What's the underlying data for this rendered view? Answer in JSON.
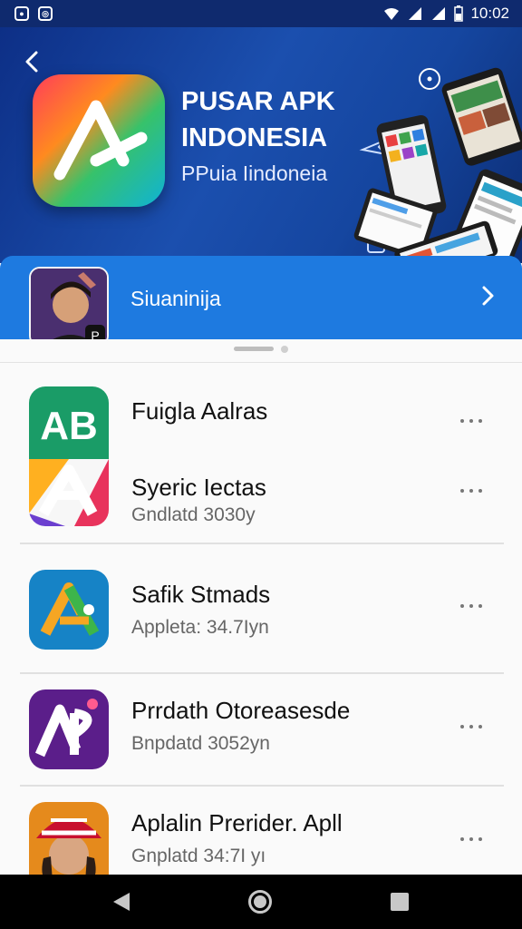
{
  "status_bar": {
    "time": "10:02"
  },
  "hero": {
    "title": "PUSAR APK INDONESIA",
    "subtitle": "PPuia Iindoneia"
  },
  "account": {
    "name": "Siuaninija"
  },
  "apps": [
    {
      "title": "Fuigla Aalras",
      "subtitle": ""
    },
    {
      "title": "Syeric Iectas",
      "subtitle": "Gndlatd 3030y"
    },
    {
      "title": "Safik Stmads",
      "subtitle": "Appleta: 34.7Iyn"
    },
    {
      "title": "Prrdath Otoreasesde",
      "subtitle": "Bnpdatd 3052yn"
    },
    {
      "title": "Aplalin Prerider. Apll",
      "subtitle": "Gnplatd 34:7I yı"
    }
  ],
  "colors": {
    "accent": "#1e7ae0",
    "hero_bg": "#1b4fae",
    "status_bg": "#0f2a6e"
  }
}
